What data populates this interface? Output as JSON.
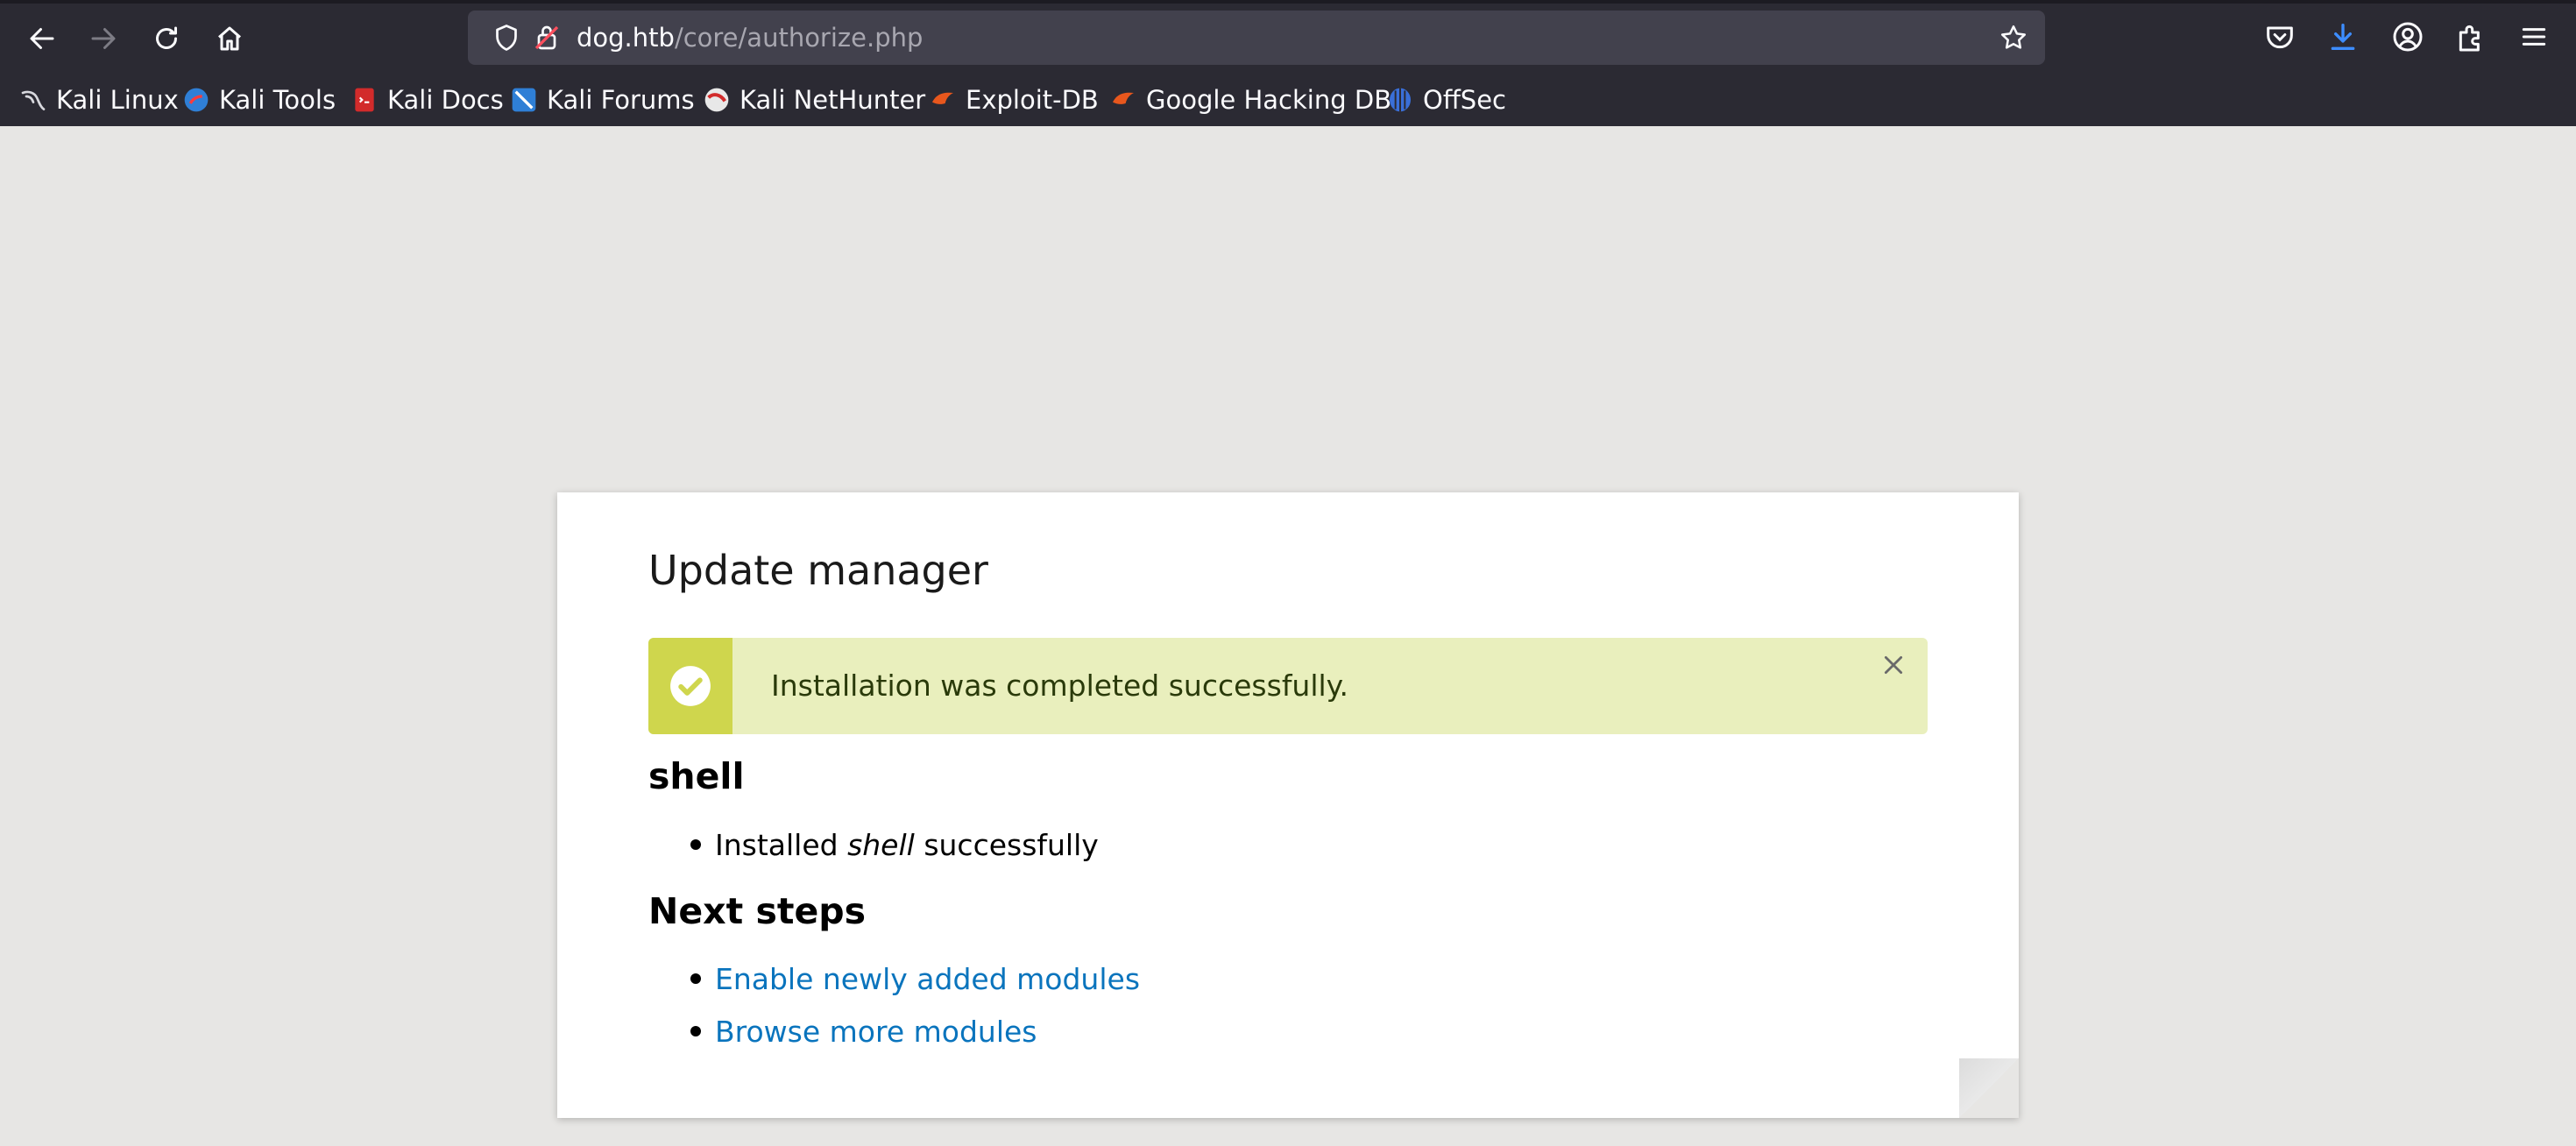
{
  "browser": {
    "url_host": "dog.htb",
    "url_path": "/core/authorize.php",
    "bookmarks": [
      {
        "label": "Kali Linux",
        "icon": "kali-dragon-icon"
      },
      {
        "label": "Kali Tools",
        "icon": "kali-tools-icon"
      },
      {
        "label": "Kali Docs",
        "icon": "kali-docs-icon"
      },
      {
        "label": "Kali Forums",
        "icon": "kali-forums-icon"
      },
      {
        "label": "Kali NetHunter",
        "icon": "kali-nethunter-icon"
      },
      {
        "label": "Exploit-DB",
        "icon": "exploit-db-icon"
      },
      {
        "label": "Google Hacking DB",
        "icon": "ghdb-icon"
      },
      {
        "label": "OffSec",
        "icon": "offsec-icon"
      }
    ]
  },
  "page": {
    "title": "Update manager",
    "status_message": "Installation was completed successfully.",
    "project_heading": "shell",
    "install_result": {
      "prefix": "Installed ",
      "name": "shell",
      "suffix": " successfully"
    },
    "next_steps_heading": "Next steps",
    "next_steps": [
      "Enable newly added modules",
      "Browse more modules"
    ]
  },
  "colors": {
    "status_bg": "#e9efbd",
    "status_stripe": "#cfd64d",
    "link": "#0a74bd",
    "page_bg": "#e7e6e4",
    "chrome_bg": "#2b2a33"
  }
}
